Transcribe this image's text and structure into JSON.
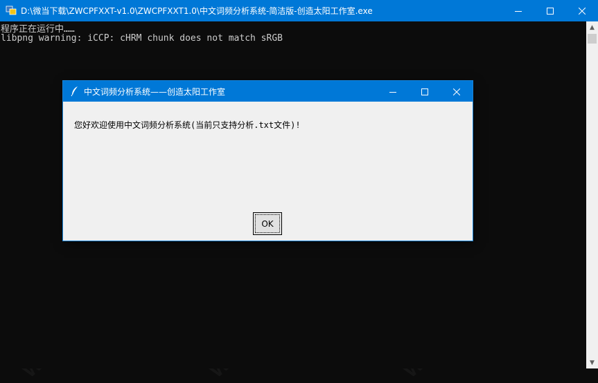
{
  "console": {
    "title": "D:\\微当下载\\ZWCPFXXT-v1.0\\ZWCPFXXT1.0\\中文词频分析系统-简洁版-创造太阳工作室.exe",
    "lines": [
      "程序正在运行中……",
      "libpng warning: iCCP: cHRM chunk does not match sRGB"
    ]
  },
  "dialog": {
    "title": "中文词频分析系统——创造太阳工作室",
    "message": "您好欢迎使用中文词频分析系统(当前只支持分析.txt文件)!",
    "ok_label": "OK"
  },
  "watermark": "WEIDOWN.COM",
  "colors": {
    "titlebar": "#0078d7",
    "console_bg": "#0c0c0c",
    "console_text": "#cccccc",
    "dialog_bg": "#f0f0f0"
  }
}
